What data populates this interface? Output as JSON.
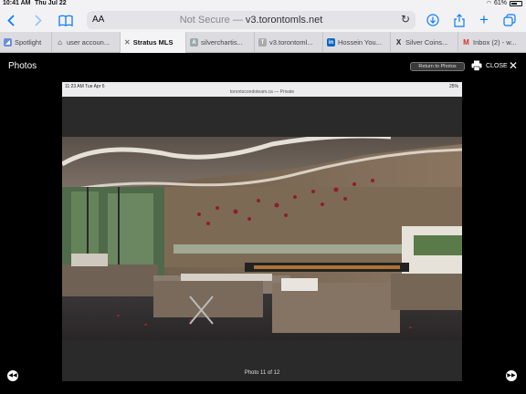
{
  "status": {
    "time": "10:41 AM",
    "date": "Thu Jul 22",
    "battery": "61%",
    "battery_fraction": 0.61
  },
  "browser": {
    "address": {
      "aa": "AA",
      "security": "Not Secure —",
      "host": "v3.torontomls.net"
    },
    "icons": [
      "back-icon",
      "forward-icon",
      "book-icon",
      "reload-icon",
      "download-icon",
      "share-icon",
      "new-tab-icon",
      "tabs-icon"
    ],
    "tabs": [
      {
        "label": "Spotlight",
        "favicon": "spotlight",
        "color": "#6b8fd6",
        "active": false
      },
      {
        "label": "user accoun...",
        "favicon": "home",
        "color": "#333",
        "active": false
      },
      {
        "label": "Stratus MLS",
        "favicon": "x",
        "color": "#555",
        "active": true
      },
      {
        "label": "silverchartis...",
        "favicon": "A",
        "color": "#9aa",
        "active": false
      },
      {
        "label": "v3.torontoml...",
        "favicon": "T",
        "color": "#aaa",
        "active": false
      },
      {
        "label": "Hossein You...",
        "favicon": "in",
        "color": "#0a66c2",
        "active": false
      },
      {
        "label": "Silver Coins...",
        "favicon": "X",
        "color": "#222",
        "active": false
      },
      {
        "label": "Inbox (2) - w...",
        "favicon": "M",
        "color": "#d93025",
        "active": false
      }
    ]
  },
  "viewer": {
    "title": "Photos",
    "return_label": "Return to Photos",
    "close_label": "CLOSE",
    "counter": "Photo 11 of 12",
    "inner": {
      "time": "11:23 AM  Tue Apr 6",
      "url": "torontocondoteam.ca — Private",
      "battery": "25%"
    }
  }
}
